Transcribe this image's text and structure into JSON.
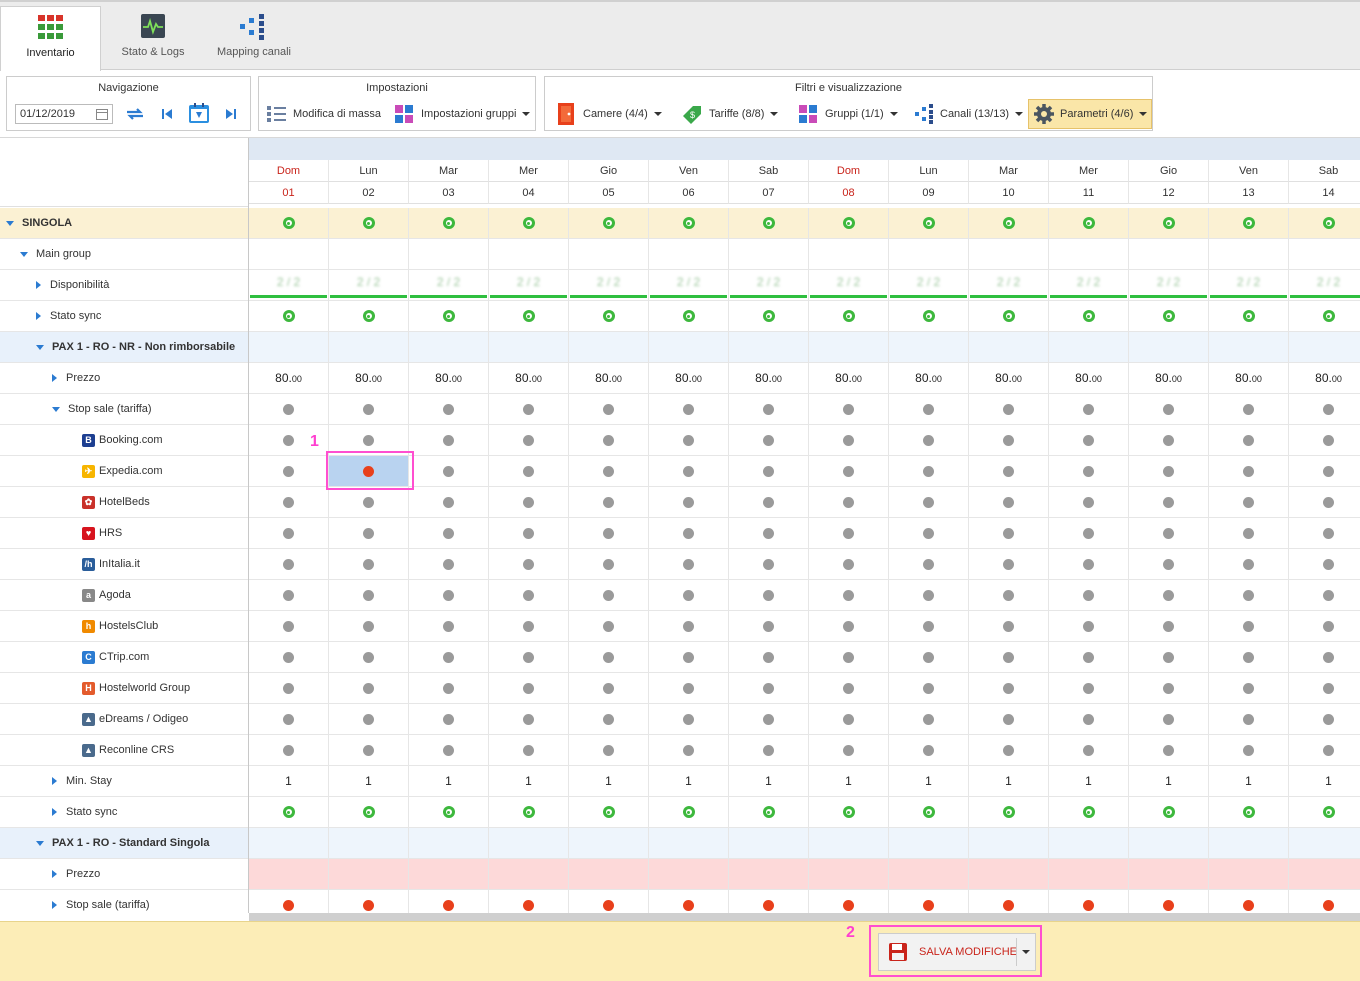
{
  "tabs": [
    {
      "label": "Inventario",
      "active": true
    },
    {
      "label": "Stato & Logs"
    },
    {
      "label": "Mapping canali"
    }
  ],
  "navigazione": {
    "title": "Navigazione",
    "date": "01/12/2019"
  },
  "impostazioni": {
    "title": "Impostazioni",
    "bulk": "Modifica di massa",
    "groups": "Impostazioni gruppi"
  },
  "filtri": {
    "title": "Filtri e visualizzazione",
    "camere": "Camere (4/4)",
    "tariffe": "Tariffe (8/8)",
    "gruppi": "Gruppi (1/1)",
    "canali": "Canali (13/13)",
    "parametri": "Parametri (4/6)"
  },
  "days": [
    {
      "dow": "Dom",
      "d": "01",
      "sun": true
    },
    {
      "dow": "Lun",
      "d": "02"
    },
    {
      "dow": "Mar",
      "d": "03"
    },
    {
      "dow": "Mer",
      "d": "04"
    },
    {
      "dow": "Gio",
      "d": "05"
    },
    {
      "dow": "Ven",
      "d": "06"
    },
    {
      "dow": "Sab",
      "d": "07"
    },
    {
      "dow": "Dom",
      "d": "08",
      "sun": true
    },
    {
      "dow": "Lun",
      "d": "09"
    },
    {
      "dow": "Mar",
      "d": "10"
    },
    {
      "dow": "Mer",
      "d": "11"
    },
    {
      "dow": "Gio",
      "d": "12"
    },
    {
      "dow": "Ven",
      "d": "13"
    },
    {
      "dow": "Sab",
      "d": "14"
    }
  ],
  "rows": [
    {
      "label": "SINGOLA",
      "level": 0,
      "exp": "down",
      "bg": "#fbf1d3",
      "bold": true,
      "cells": "green"
    },
    {
      "label": "Main group",
      "level": 1,
      "exp": "down",
      "cells": "none"
    },
    {
      "label": "Disponibilità",
      "level": 2,
      "exp": "right",
      "cells": "avail"
    },
    {
      "label": "Stato sync",
      "level": 2,
      "exp": "right",
      "cells": "green"
    },
    {
      "label": "PAX 1 - RO - NR - Non rimborsabile",
      "level": 2,
      "exp": "down",
      "bg": "#e8f1fb",
      "bold": true,
      "cells": "none",
      "rowbg": "#eef5fc"
    },
    {
      "label": "Prezzo",
      "level": 3,
      "exp": "right",
      "cells": "price"
    },
    {
      "label": "Stop sale (tariffa)",
      "level": 3,
      "exp": "down",
      "cells": "gray"
    },
    {
      "label": "Booking.com",
      "level": 4,
      "logo": "#1d3f91",
      "logoText": "B",
      "cells": "gray"
    },
    {
      "label": "Expedia.com",
      "level": 4,
      "logo": "#f7b500",
      "logoText": "✈",
      "cells": "expedia"
    },
    {
      "label": "HotelBeds",
      "level": 4,
      "logo": "#c9312a",
      "logoText": "✿",
      "cells": "gray"
    },
    {
      "label": "HRS",
      "level": 4,
      "logo": "#d7141e",
      "logoText": "♥",
      "cells": "gray"
    },
    {
      "label": "InItalia.it",
      "level": 4,
      "logo": "#2a5d9a",
      "logoText": "/h",
      "cells": "gray"
    },
    {
      "label": "Agoda",
      "level": 4,
      "logo": "#888",
      "logoText": "a",
      "cells": "gray"
    },
    {
      "label": "HostelsClub",
      "level": 4,
      "logo": "#f08a00",
      "logoText": "h",
      "cells": "gray"
    },
    {
      "label": "CTrip.com",
      "level": 4,
      "logo": "#2b7bd1",
      "logoText": "C",
      "cells": "gray"
    },
    {
      "label": "Hostelworld Group",
      "level": 4,
      "logo": "#e35b2c",
      "logoText": "H",
      "cells": "gray"
    },
    {
      "label": "eDreams / Odigeo",
      "level": 4,
      "logo": "#4a6a8c",
      "logoText": "▲",
      "cells": "gray"
    },
    {
      "label": "Reconline CRS",
      "level": 4,
      "logo": "#4a6a8c",
      "logoText": "▲",
      "cells": "gray"
    },
    {
      "label": "Min. Stay",
      "level": 3,
      "exp": "right",
      "cells": "one"
    },
    {
      "label": "Stato sync",
      "level": 3,
      "exp": "right",
      "cells": "green"
    },
    {
      "label": "PAX 1 - RO - Standard Singola",
      "level": 2,
      "exp": "down",
      "bg": "#e8f1fb",
      "bold": true,
      "cells": "none",
      "rowbg": "#eef5fc"
    },
    {
      "label": "Prezzo",
      "level": 3,
      "exp": "right",
      "cells": "pink"
    },
    {
      "label": "Stop sale (tariffa)",
      "level": 3,
      "exp": "right",
      "cells": "red"
    }
  ],
  "values": {
    "price_int": "80.",
    "price_dec": "00",
    "min_stay": "1",
    "avail": "2 / 2"
  },
  "footer": {
    "save": "SALVA MODIFICHE"
  },
  "annotations": {
    "one": "1",
    "two": "2"
  }
}
